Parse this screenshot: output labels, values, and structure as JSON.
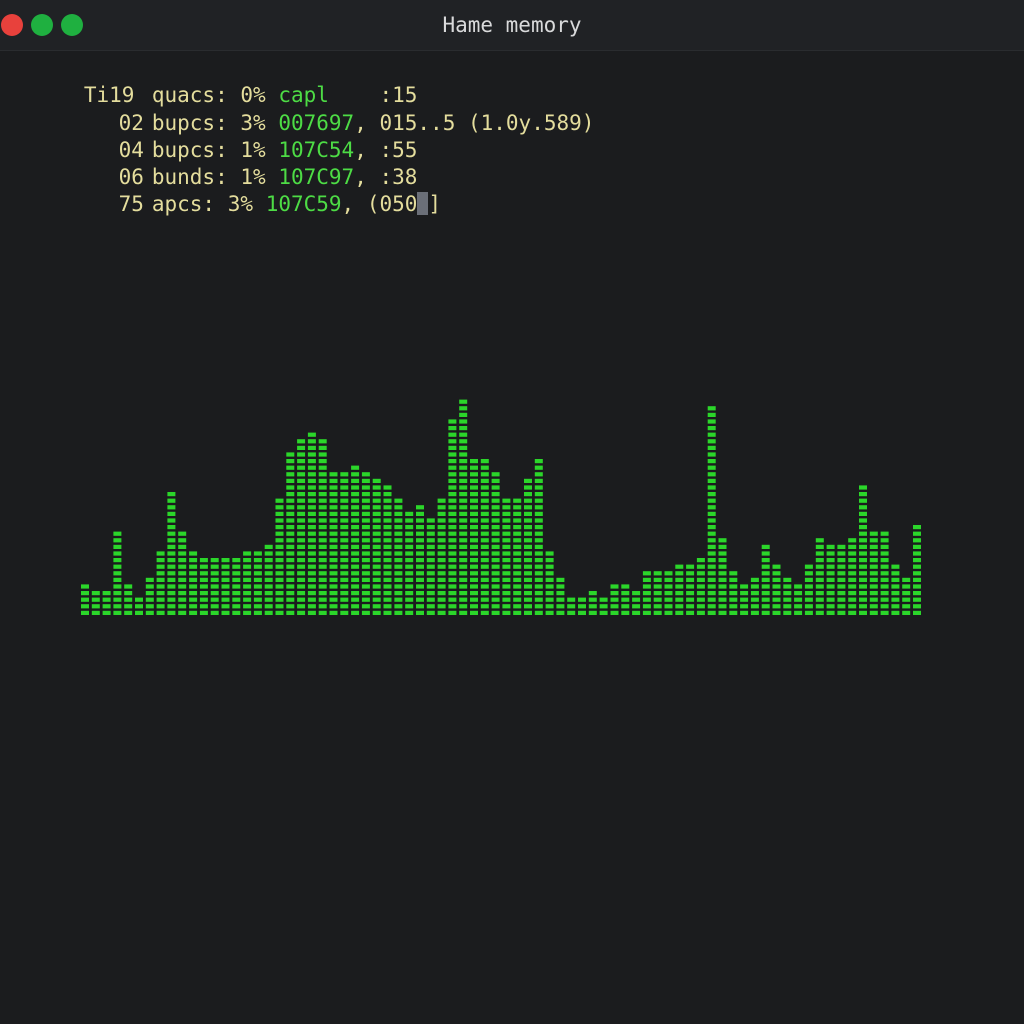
{
  "window": {
    "title": "Hame memory",
    "controls": [
      {
        "name": "close-button",
        "color": "#e8413c"
      },
      {
        "name": "minimize-button",
        "color": "#1fb040"
      },
      {
        "name": "maximize-button",
        "color": "#1fb040"
      }
    ]
  },
  "terminal": {
    "rows": [
      {
        "id": "Ti19",
        "name": "quacs:",
        "pct": "0%",
        "addr": "capl",
        "tail": "    :15"
      },
      {
        "id": "02",
        "name": "bupcs:",
        "pct": "3%",
        "addr": "007697",
        "tail": ", 015..5 (1.0y.589)"
      },
      {
        "id": "04",
        "name": "bupcs:",
        "pct": "1%",
        "addr": "107C54",
        "tail": ", :55"
      },
      {
        "id": "06",
        "name": "bunds:",
        "pct": "1%",
        "addr": "107C97",
        "tail": ", :38"
      },
      {
        "id": "75",
        "name": "apcs:",
        "pct": "3%",
        "addr": "107C59",
        "tail": ", (050"
      }
    ],
    "cursor_tail": "]",
    "colors": {
      "text": "#e4dd9d",
      "accent": "#4ddc45",
      "background": "#1b1c1e"
    }
  },
  "graph": {
    "color": "#2bd62a",
    "bar_levels": [
      5,
      4,
      4,
      13,
      5,
      3,
      6,
      10,
      19,
      13,
      10,
      9,
      9,
      9,
      9,
      10,
      10,
      11,
      18,
      25,
      27,
      28,
      27,
      22,
      22,
      23,
      22,
      21,
      20,
      18,
      16,
      17,
      15,
      18,
      30,
      33,
      24,
      24,
      22,
      18,
      18,
      21,
      24,
      10,
      6,
      3,
      3,
      4,
      3,
      5,
      5,
      4,
      7,
      7,
      7,
      8,
      8,
      9,
      32,
      12,
      7,
      5,
      6,
      11,
      8,
      6,
      5,
      8,
      12,
      11,
      11,
      12,
      20,
      13,
      13,
      8,
      6,
      14
    ]
  }
}
